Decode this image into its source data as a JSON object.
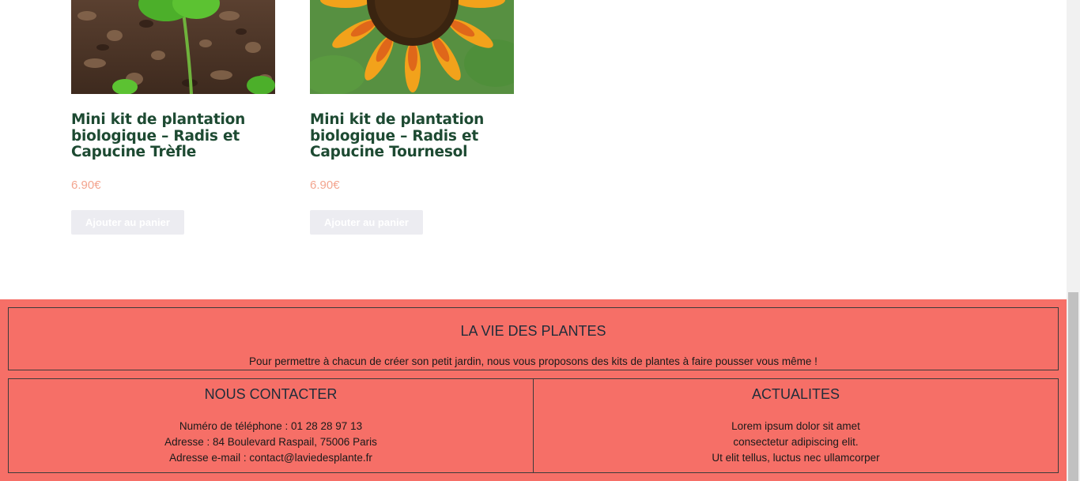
{
  "products": [
    {
      "title": "Mini kit de plantation biologique – Radis et Capucine Trèfle",
      "price": "6.90€",
      "button": "Ajouter au panier",
      "image": "clover-seedling-photo"
    },
    {
      "title": "Mini kit de plantation biologique – Radis et Capucine Tournesol",
      "price": "6.90€",
      "button": "Ajouter au panier",
      "image": "sunflower-photo"
    }
  ],
  "footer": {
    "about": {
      "heading": "LA VIE DES PLANTES",
      "text": "Pour permettre à chacun de créer son petit jardin, nous vous proposons des kits de plantes à faire pousser vous même !"
    },
    "contact": {
      "heading": "NOUS CONTACTER",
      "phone": "Numéro de téléphone : 01 28 28 97 13",
      "address": "Adresse : 84 Boulevard Raspail, 75006 Paris",
      "email": "Adresse e-mail : contact@laviedesplante.fr"
    },
    "news": {
      "heading": "ACTUALITES",
      "lines": [
        "Lorem ipsum dolor sit amet",
        "consectetur adipiscing elit.",
        "Ut elit tellus, luctus nec ullamcorper"
      ]
    }
  },
  "colors": {
    "footer_bg": "#f66f67",
    "title": "#1d4a32",
    "price": "#f3a58f",
    "button_bg": "#ececf1"
  }
}
